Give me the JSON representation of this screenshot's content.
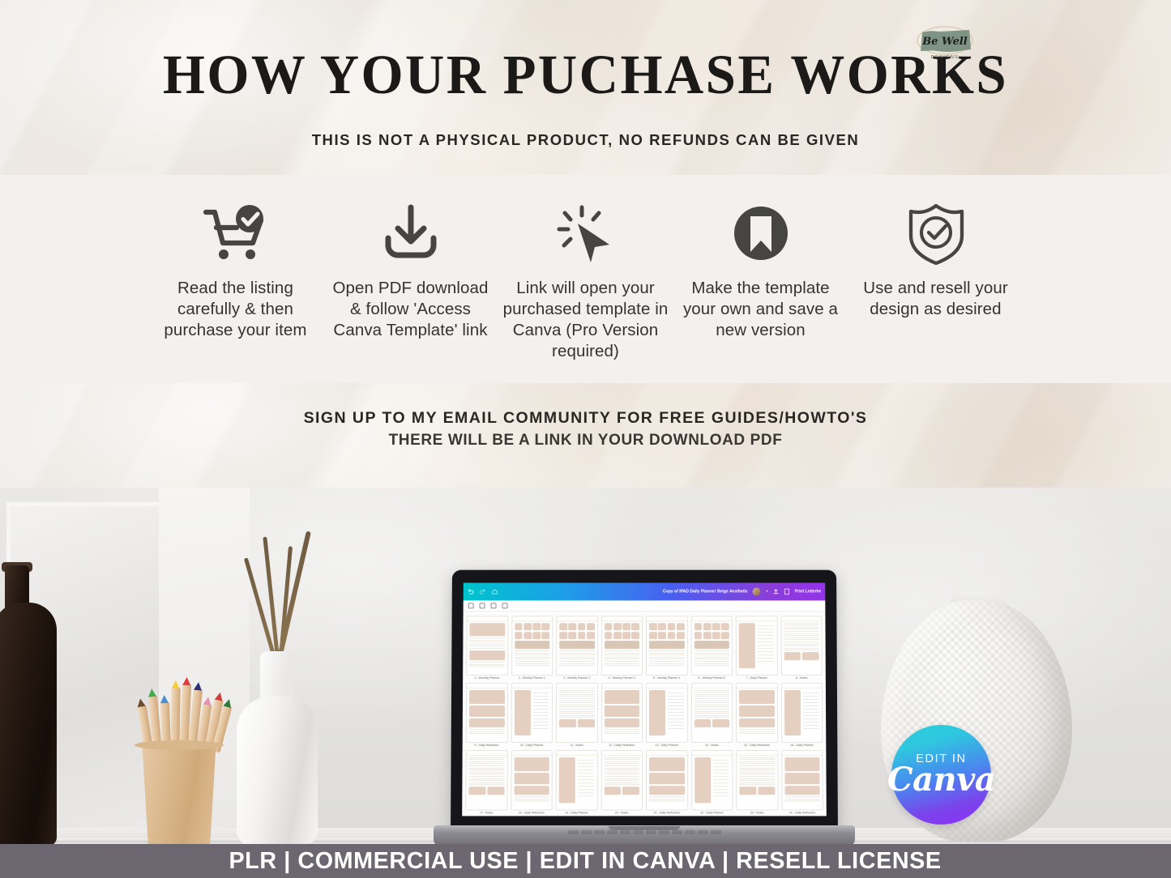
{
  "header": {
    "title": "HOW YOUR PUCHASE WORKS",
    "subtitle": "THIS IS NOT A PHYSICAL PRODUCT, NO REFUNDS CAN BE GIVEN",
    "logo": {
      "brand": "Be Well",
      "tagline": "DESIGNS",
      "brush_color": "#7f9485"
    }
  },
  "steps": {
    "band_color": "#f4f0ee",
    "icon_color": "#464542",
    "items": [
      {
        "icon": "shopping-cart-check-icon",
        "text": "Read the listing carefully & then purchase your item"
      },
      {
        "icon": "download-icon",
        "text": "Open PDF download & follow 'Access Canva Template' link"
      },
      {
        "icon": "cursor-click-icon",
        "text": "Link will open your purchased template in Canva (Pro Version required)"
      },
      {
        "icon": "bookmark-circle-icon",
        "text": "Make the template your own and save a new version"
      },
      {
        "icon": "shield-check-icon",
        "text": "Use and resell your design as desired"
      }
    ]
  },
  "cta": {
    "line1": "SIGN UP TO MY EMAIL COMMUNITY FOR FREE GUIDES/HOWTO'S",
    "line2": "THERE WILL BE A LINK IN YOUR DOWNLOAD PDF"
  },
  "laptop": {
    "app": "Canva",
    "document_title": "Copy of iPAD Daily Planner Beige Aesthetic",
    "plus_label": "+",
    "share_button": "Print Letterhe",
    "pages": [
      "1 - Monthly Planner",
      "2 - Weekly Planner 1",
      "3 - Weekly Planner 2",
      "4 - Weekly Planner 3",
      "5 - Weekly Planner 4",
      "6 - Weekly Planner 5",
      "7 - Daily Planner",
      "8 - Notes",
      "9 - Daily Reflection",
      "10 - Daily Planner",
      "11 - Notes",
      "12 - Daily Reflection",
      "13 - Daily Planner",
      "14 - Notes",
      "15 - Daily Reflection",
      "16 - Daily Planner",
      "17 - Notes",
      "18 - Daily Reflection",
      "19 - Daily Planner",
      "20 - Notes",
      "21 - Daily Reflection",
      "22 - Daily Planner",
      "23 - Notes",
      "24 - Daily Reflection"
    ]
  },
  "canva_badge": {
    "top_label": "EDIT IN",
    "brand": "Canva",
    "gradient_from": "#29d0d8",
    "gradient_to": "#8d2ff5"
  },
  "footer": {
    "text": "PLR | COMMERCIAL USE | EDIT IN CANVA | RESELL LICENSE",
    "bar_color": "#6b6670"
  }
}
